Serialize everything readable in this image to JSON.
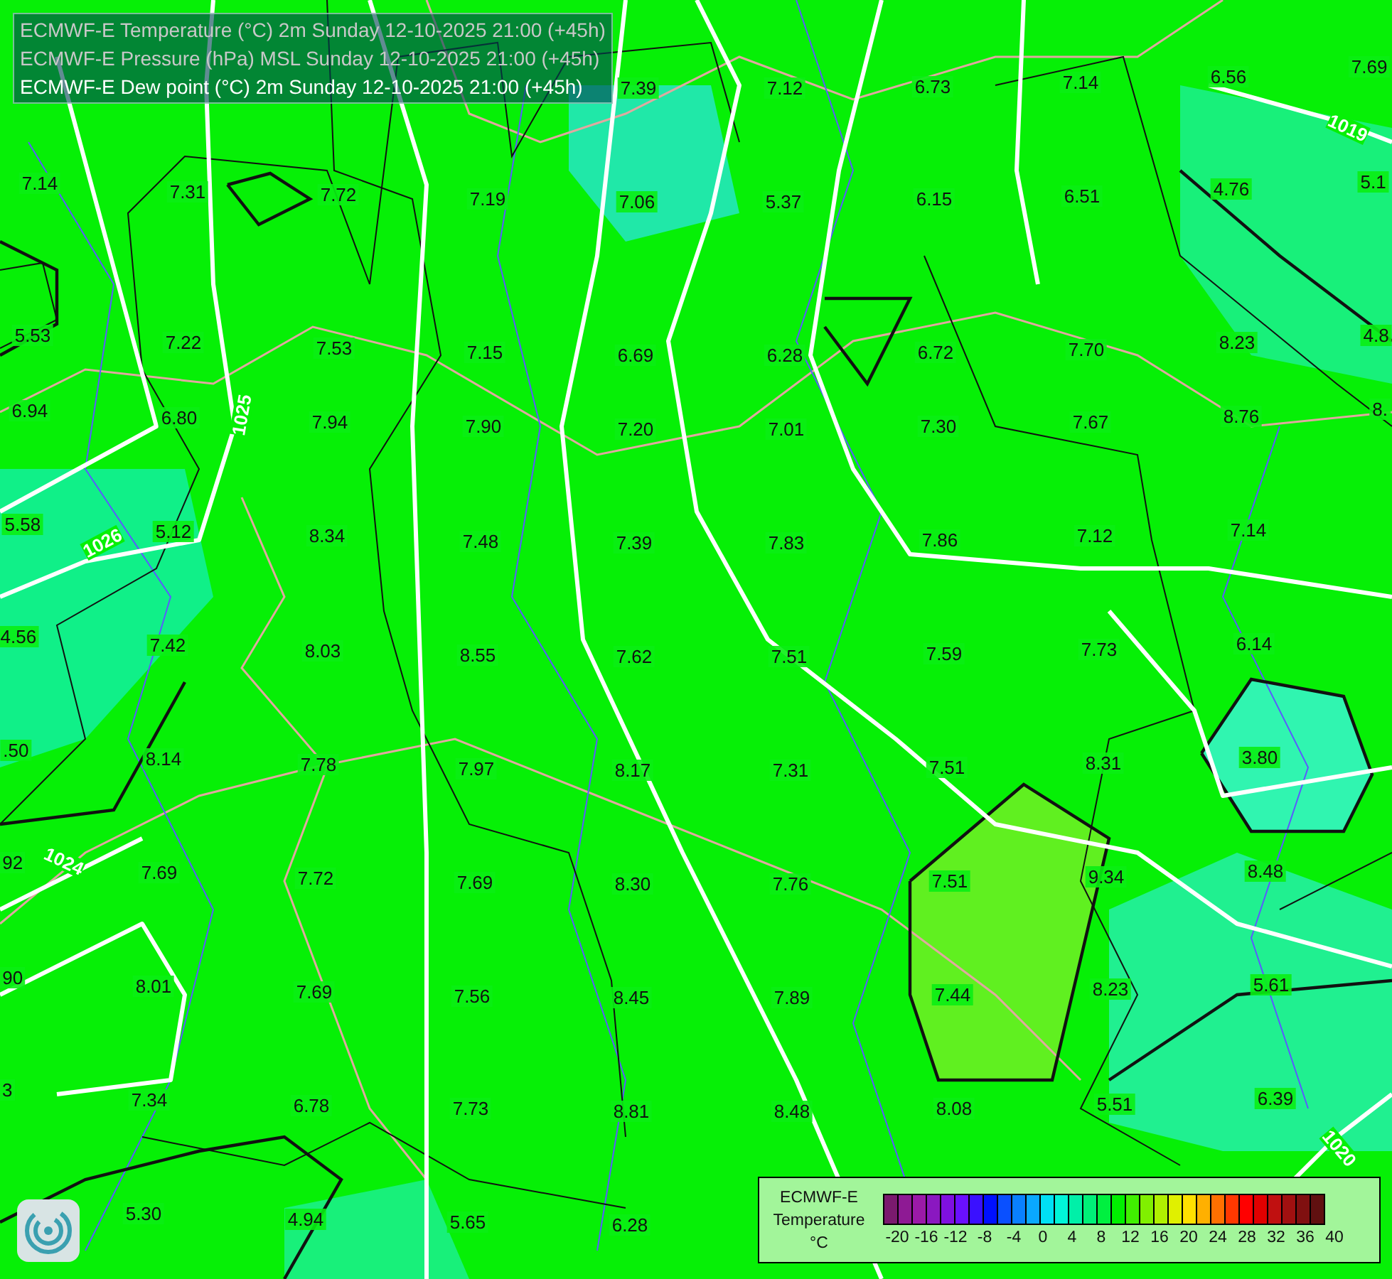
{
  "header": [
    {
      "text": "ECMWF-E Temperature (°C) 2m Sunday 12-10-2025 21:00 (+45h)",
      "selected": false
    },
    {
      "text": "ECMWF-E Pressure (hPa) MSL Sunday 12-10-2025 21:00 (+45h)",
      "selected": false
    },
    {
      "text": "ECMWF-E Dew point (°C) 2m Sunday 12-10-2025 21:00 (+45h)",
      "selected": true
    }
  ],
  "values": [
    "7.39",
    "7.12",
    "6.73",
    "7.14",
    "6.56",
    "7.69",
    "7.14",
    "7.31",
    "7.72",
    "7.19",
    "7.06",
    "5.37",
    "6.15",
    "6.51",
    "4.76",
    "5.1",
    "5.53",
    "7.22",
    "7.53",
    "7.15",
    "6.69",
    "6.28",
    "6.72",
    "7.70",
    "8.23",
    "4.8",
    "6.94",
    "6.80",
    "7.94",
    "7.90",
    "7.20",
    "7.01",
    "7.30",
    "7.67",
    "8.76",
    "8.",
    "5.58",
    "5.12",
    "8.34",
    "7.48",
    "7.39",
    "7.83",
    "7.86",
    "7.12",
    "7.14",
    "4.56",
    "7.42",
    "8.03",
    "8.55",
    "7.62",
    "7.51",
    "7.59",
    "7.73",
    "6.14",
    ".50",
    "8.14",
    "7.78",
    "7.97",
    "8.17",
    "7.31",
    "7.51",
    "8.31",
    "3.80",
    "92",
    "7.69",
    "7.72",
    "7.69",
    "8.30",
    "7.76",
    "7.51",
    "9.34",
    "8.48",
    "90",
    "8.01",
    "7.69",
    "7.56",
    "8.45",
    "7.89",
    "7.44",
    "8.23",
    "5.61",
    "3",
    "7.34",
    "6.78",
    "7.73",
    "8.81",
    "8.48",
    "8.08",
    "5.51",
    "6.39",
    "5.30",
    "4.94",
    "5.65",
    "6.28"
  ],
  "isobar_labels": [
    "1019",
    "1025",
    "1026",
    "1024",
    "1020"
  ],
  "legend": {
    "title": "ECMWF-E",
    "subtitle": "Temperature",
    "unit": "°C",
    "swatches": [
      {
        "color": "#7a1a6e"
      },
      {
        "color": "#8e1a94"
      },
      {
        "color": "#9b1aa8"
      },
      {
        "color": "#8a18c0"
      },
      {
        "color": "#7f10e0"
      },
      {
        "color": "#6a10ff"
      },
      {
        "color": "#3a10ff"
      },
      {
        "color": "#0010ff"
      },
      {
        "color": "#0a50ff"
      },
      {
        "color": "#0a80ff"
      },
      {
        "color": "#0aa8ff"
      },
      {
        "color": "#00e0f5"
      },
      {
        "color": "#00f5d8"
      },
      {
        "color": "#00f0a8"
      },
      {
        "color": "#00f078"
      },
      {
        "color": "#00f040"
      },
      {
        "color": "#00f000"
      },
      {
        "color": "#40f000"
      },
      {
        "color": "#80f000"
      },
      {
        "color": "#b0f000"
      },
      {
        "color": "#e0f000"
      },
      {
        "color": "#ffe000"
      },
      {
        "color": "#ffb000"
      },
      {
        "color": "#ff7000"
      },
      {
        "color": "#ff3800"
      },
      {
        "color": "#ff0000"
      },
      {
        "color": "#e00000"
      },
      {
        "color": "#c01010"
      },
      {
        "color": "#a01010"
      },
      {
        "color": "#801010"
      },
      {
        "color": "#601010"
      }
    ],
    "ticks": [
      "-20",
      "-16",
      "-12",
      "-8",
      "-4",
      "0",
      "4",
      "8",
      "12",
      "16",
      "20",
      "24",
      "28",
      "32",
      "36",
      "40"
    ]
  }
}
